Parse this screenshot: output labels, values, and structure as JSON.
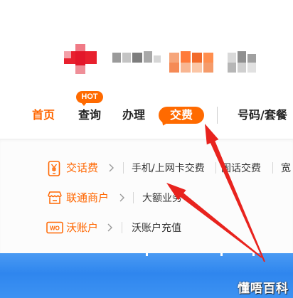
{
  "nav": {
    "items": [
      {
        "label": "首页",
        "active": true
      },
      {
        "label": "查询",
        "badge": "HOT"
      },
      {
        "label": "办理"
      },
      {
        "label": "交费",
        "highlighted": true
      },
      {
        "label": "号码/套餐"
      }
    ]
  },
  "menu": {
    "rows": [
      {
        "category": "交话费",
        "icon": "phone-bill-icon",
        "links": [
          "手机/上网卡交费",
          "固话交费",
          "宽"
        ]
      },
      {
        "category": "联通商户",
        "icon": "store-icon",
        "links": [
          "大额业务"
        ]
      },
      {
        "category": "沃账户",
        "icon": "wo-account-icon",
        "links": [
          "沃账户充值"
        ]
      }
    ]
  },
  "wo_icon_text": "WO",
  "watermark": "懂唔百科",
  "colors": {
    "accent": "#ff6600",
    "pill": "#ff6a00",
    "text": "#333333",
    "banner": "#2f86ee",
    "annotation_arrow": "#e8231e"
  }
}
